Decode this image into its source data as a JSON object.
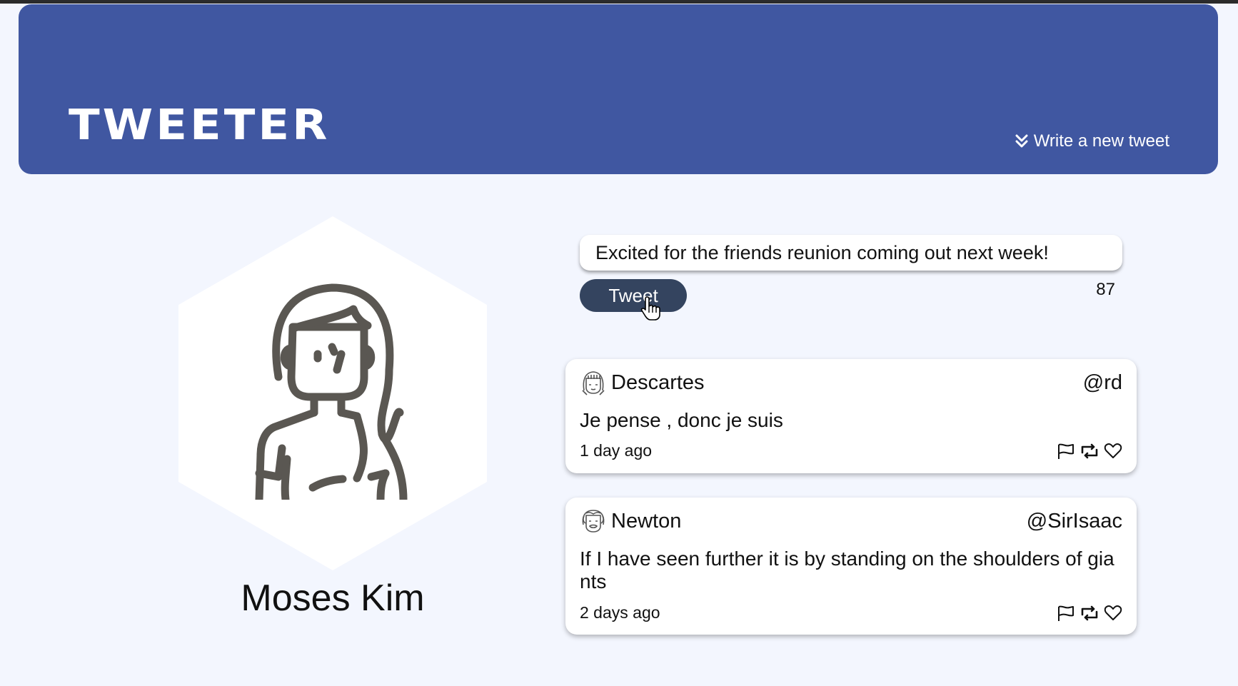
{
  "header": {
    "brand": "TWEETER",
    "compose_toggle_label": "Write a new tweet",
    "background_color": "#4057a1"
  },
  "profile": {
    "name": "Moses Kim"
  },
  "composer": {
    "value": "Excited for the friends reunion coming out next week!",
    "button_label": "Tweet",
    "char_counter": "87"
  },
  "tweets": [
    {
      "author": "Descartes",
      "handle": "@rd",
      "text": "Je pense , donc je suis",
      "time": "1 day ago"
    },
    {
      "author": "Newton",
      "handle": "@SirIsaac",
      "text": "If I have seen further it is by standing on the shoulders of giants",
      "time": "2 days ago"
    }
  ],
  "icons": {
    "compose": "double-chevron-down-icon",
    "actions": [
      "flag-icon",
      "retweet-icon",
      "heart-icon"
    ]
  }
}
